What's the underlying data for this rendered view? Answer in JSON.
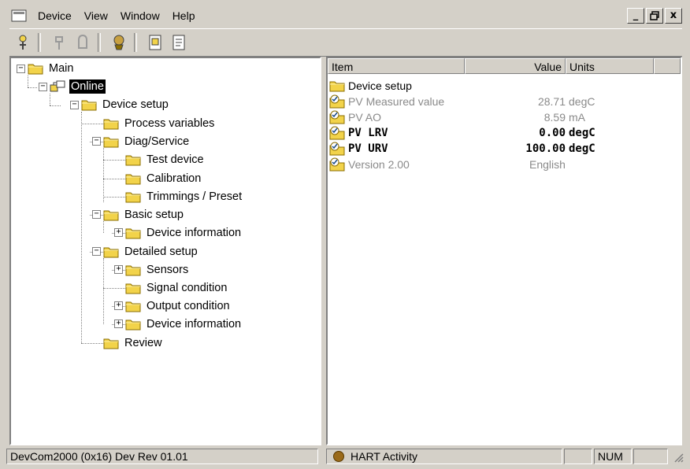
{
  "menu": [
    "Device",
    "View",
    "Window",
    "Help"
  ],
  "window_controls": {
    "minimize": "_",
    "restore": "🗗",
    "close": "x"
  },
  "toolbar": {
    "icons": [
      "connect-icon",
      "disconnect-icon",
      "lock-icon",
      "device-icon",
      "document-icon",
      "report-icon"
    ]
  },
  "tree": {
    "main": "Main",
    "online": "Online",
    "device_setup": "Device setup",
    "process_variables": "Process variables",
    "diag_service": "Diag/Service",
    "test_device": "Test device",
    "calibration": "Calibration",
    "trimmings": "Trimmings / Preset",
    "basic_setup": "Basic setup",
    "device_information_1": "Device information",
    "detailed_setup": "Detailed setup",
    "sensors": "Sensors",
    "signal_condition": "Signal condition",
    "output_condition": "Output condition",
    "device_information_2": "Device information",
    "review": "Review"
  },
  "list": {
    "headers": {
      "item": "Item",
      "value": "Value",
      "units": "Units"
    },
    "rows": [
      {
        "item": "Device setup",
        "value": "",
        "units": "",
        "style": "normal",
        "icon": "folder-icon"
      },
      {
        "item": "PV Measured value",
        "value": "28.71",
        "units": "degC",
        "style": "grey",
        "icon": "variable-icon"
      },
      {
        "item": "PV AO",
        "value": "8.59",
        "units": "mA",
        "style": "grey",
        "icon": "variable-icon"
      },
      {
        "item": "PV LRV",
        "value": "0.00",
        "units": "degC",
        "style": "bold",
        "icon": "variable-icon"
      },
      {
        "item": "PV URV",
        "value": "100.00",
        "units": "degC",
        "style": "bold",
        "icon": "variable-icon"
      },
      {
        "item": "Version 2.00",
        "value": "",
        "units": "English",
        "style": "grey",
        "icon": "variable-icon"
      }
    ]
  },
  "status": {
    "device": "DevCom2000   (0x16)  Dev Rev 01.01",
    "activity": "HART Activity",
    "num": "NUM"
  },
  "colors": {
    "folder": "#f2d34a",
    "selection": "#000000",
    "chrome": "#d4d0c8"
  }
}
